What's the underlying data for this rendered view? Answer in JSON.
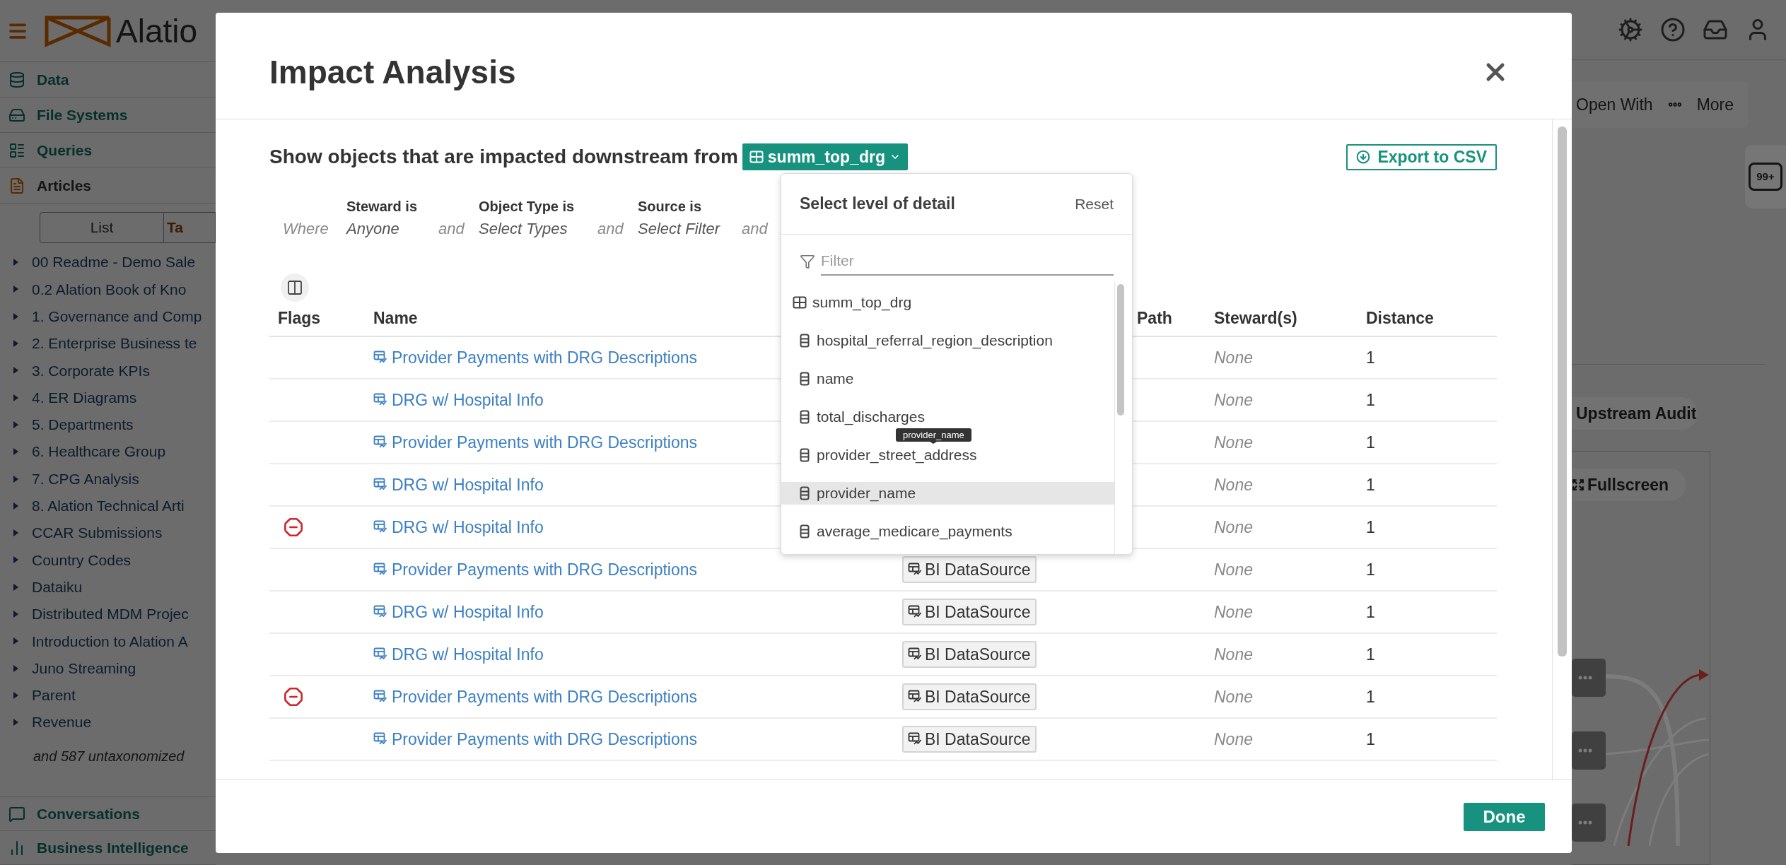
{
  "app_header": {
    "logo_text": "Alatio"
  },
  "sidebar": {
    "nav": [
      {
        "label": "Data",
        "kind": "data",
        "selected": false
      },
      {
        "label": "File Systems",
        "kind": "files",
        "selected": false
      },
      {
        "label": "Queries",
        "kind": "queries",
        "selected": false
      },
      {
        "label": "Articles",
        "kind": "articles",
        "selected": true
      }
    ],
    "view_tabs": [
      {
        "label": "List",
        "selected": false
      },
      {
        "label": "Ta",
        "selected": true
      }
    ],
    "taxonomy": [
      "00 Readme - Demo Sale",
      "0.2 Alation Book of Kno",
      "1. Governance and Comp",
      "2. Enterprise Business te",
      "3. Corporate KPIs",
      "4. ER Diagrams",
      "5. Departments",
      "6. Healthcare Group",
      "7. CPG Analysis",
      "8. Alation Technical Arti",
      "CCAR Submissions",
      "Country Codes",
      "Dataiku",
      "Distributed MDM Projec",
      "Introduction to Alation A",
      "Juno Streaming",
      "Parent",
      "Revenue"
    ],
    "more_note": "and 587 untaxonomized",
    "bottom_nav": [
      {
        "label": "Conversations",
        "kind": "conversations",
        "selected": false
      },
      {
        "label": "Business Intelligence",
        "kind": "bi",
        "selected": false
      }
    ]
  },
  "page_actions": {
    "open_with": "Open With",
    "more": "More",
    "comments_badge": "99+",
    "upstream_audit": "Upstream Audit",
    "fullscreen": "Fullscreen"
  },
  "dialog": {
    "title": "Impact Analysis",
    "intro": "Show objects that are impacted downstream from",
    "source_button": "summ_top_drg",
    "export_button": "Export to CSV",
    "filter_prefix": "Where",
    "filters": [
      {
        "label": "Steward is",
        "value": "Anyone",
        "joiner": "and"
      },
      {
        "label": "Object Type is",
        "value": "Select Types",
        "joiner": "and"
      },
      {
        "label": "Source is",
        "value": "Select Filter",
        "joiner": "and"
      }
    ],
    "table": {
      "columns": [
        "Flags",
        "Name",
        "Path",
        "Steward(s)",
        "Distance"
      ],
      "rows": [
        {
          "deprecated": false,
          "name": "Provider Payments with DRG Descriptions",
          "stewards": "None",
          "distance": "1"
        },
        {
          "deprecated": false,
          "name": "DRG w/ Hospital Info",
          "stewards": "None",
          "distance": "1"
        },
        {
          "deprecated": false,
          "name": "Provider Payments with DRG Descriptions",
          "stewards": "None",
          "distance": "1"
        },
        {
          "deprecated": false,
          "name": "DRG w/ Hospital Info",
          "stewards": "None",
          "distance": "1"
        },
        {
          "deprecated": true,
          "name": "DRG w/ Hospital Info",
          "stewards": "None",
          "distance": "1"
        },
        {
          "deprecated": false,
          "name": "Provider Payments with DRG Descriptions",
          "type": "BI DataSource",
          "stewards": "None",
          "distance": "1"
        },
        {
          "deprecated": false,
          "name": "DRG w/ Hospital Info",
          "type": "BI DataSource",
          "stewards": "None",
          "distance": "1"
        },
        {
          "deprecated": false,
          "name": "DRG w/ Hospital Info",
          "type": "BI DataSource",
          "stewards": "None",
          "distance": "1"
        },
        {
          "deprecated": true,
          "name": "Provider Payments with DRG Descriptions",
          "type": "BI DataSource",
          "stewards": "None",
          "distance": "1"
        },
        {
          "deprecated": false,
          "name": "Provider Payments with DRG Descriptions",
          "type": "BI DataSource",
          "stewards": "None",
          "distance": "1"
        }
      ]
    },
    "level_menu": {
      "title": "Select level of detail",
      "reset": "Reset",
      "filter_placeholder": "Filter",
      "root": {
        "label": "summ_top_drg",
        "highlighted": false,
        "children": [
          {
            "label": "hospital_referral_region_description",
            "highlighted": false
          },
          {
            "label": "name",
            "highlighted": false
          },
          {
            "label": "total_discharges",
            "highlighted": false
          },
          {
            "label": "provider_street_address",
            "highlighted": false
          },
          {
            "label": "provider_name",
            "highlighted": true
          },
          {
            "label": "average_medicare_payments",
            "highlighted": false
          }
        ]
      },
      "tooltip": "provider_name"
    },
    "done_button": "Done"
  }
}
